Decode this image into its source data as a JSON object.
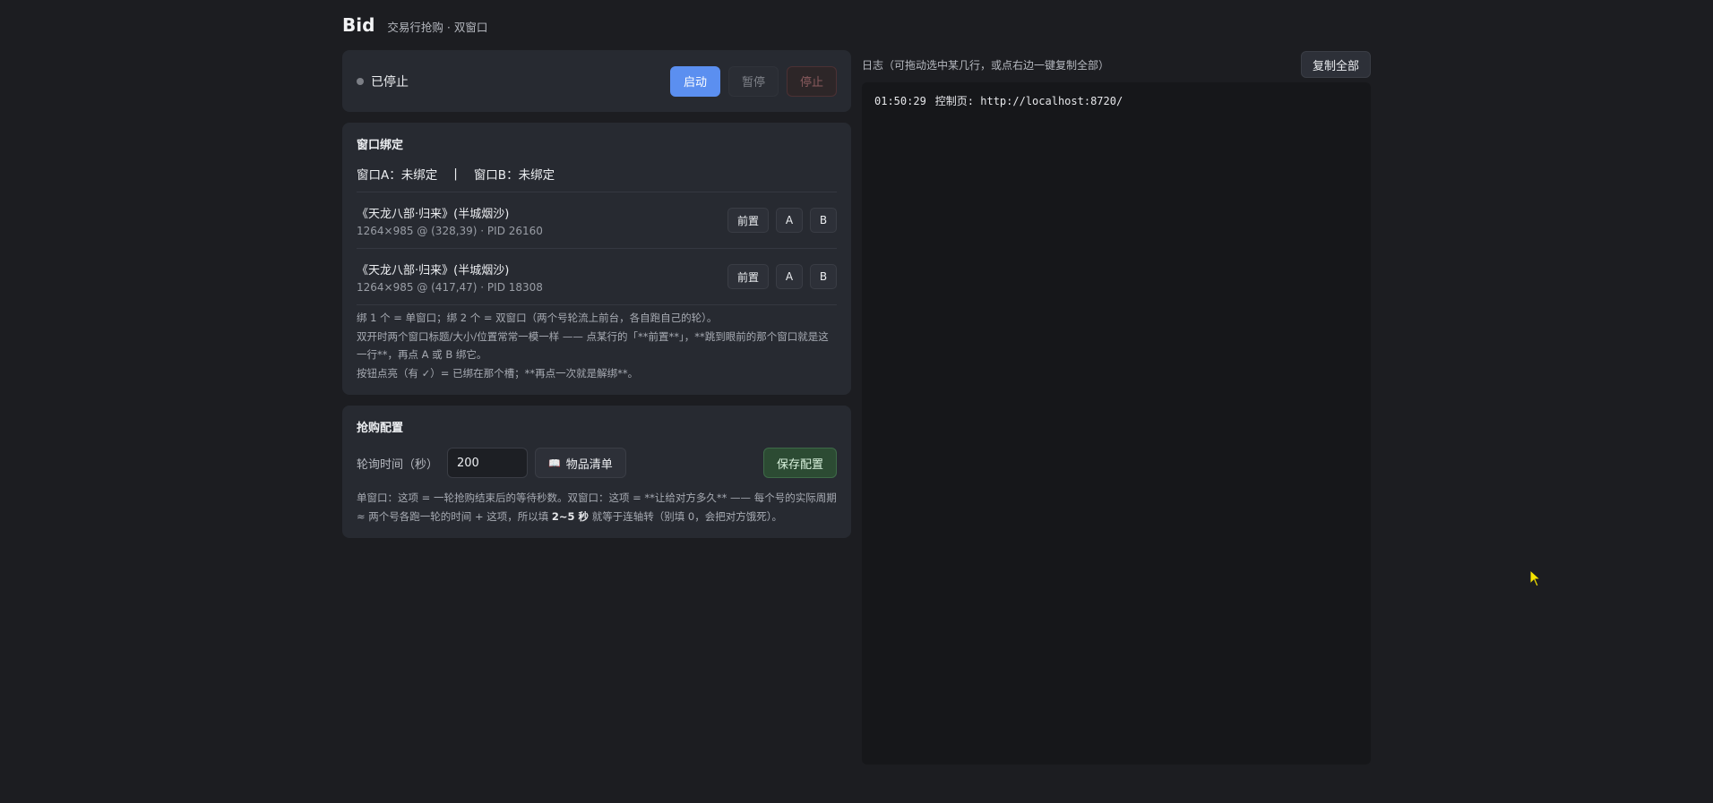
{
  "header": {
    "title": "Bid",
    "subtitle": "交易行抢购 · 双窗口"
  },
  "status": {
    "state_text": "已停止",
    "start_label": "启动",
    "pause_label": "暂停",
    "stop_label": "停止"
  },
  "binding": {
    "title": "窗口绑定",
    "window_a": "窗口A：未绑定",
    "separator": "|",
    "window_b": "窗口B：未绑定",
    "windows": [
      {
        "title": "《天龙八部·归来》(半城烟沙)",
        "meta": "1264×985 @ (328,39) · PID 26160",
        "front_label": "前置",
        "a_label": "A",
        "b_label": "B"
      },
      {
        "title": "《天龙八部·归来》(半城烟沙)",
        "meta": "1264×985 @ (417,47) · PID 18308",
        "front_label": "前置",
        "a_label": "A",
        "b_label": "B"
      }
    ],
    "help_1": "绑 1 个 = 单窗口；绑 2 个 = 双窗口（两个号轮流上前台，各自跑自己的轮）。",
    "help_2": "双开时两个窗口标题/大小/位置常常一模一样 —— 点某行的「**前置**」，**跳到眼前的那个窗口就是这一行**，再点 A 或 B 绑它。",
    "help_3": "按钮点亮（有 ✓）= 已绑在那个槽；**再点一次就是解绑**。"
  },
  "config": {
    "title": "抢购配置",
    "poll_label": "轮询时间（秒）",
    "poll_value": "200",
    "items_icon": "book-icon",
    "items_label": "物品清单",
    "save_label": "保存配置",
    "help_a": "单窗口：这项 = 一轮抢购结束后的等待秒数。双窗口：这项 = **让给对方多久** —— 每个号的实际周期 ≈ 两个号各跑一轮的时间 + 这项，所以填 ",
    "help_bold": "2~5 秒",
    "help_b": " 就等于连轴转（别填 0，会把对方饿死）。"
  },
  "log": {
    "hint": "日志（可拖动选中某几行，或点右边一键复制全部）",
    "copy_label": "复制全部",
    "lines": [
      {
        "time": "01:50:29",
        "text": "控制页: http://localhost:8720/"
      }
    ]
  },
  "colors": {
    "accent": "#5b8ff0",
    "save": "#2c4b33",
    "stop": "#8a5b5e",
    "bg": "#1c1d21",
    "card": "#272a31",
    "cursor": "#f5e400"
  }
}
